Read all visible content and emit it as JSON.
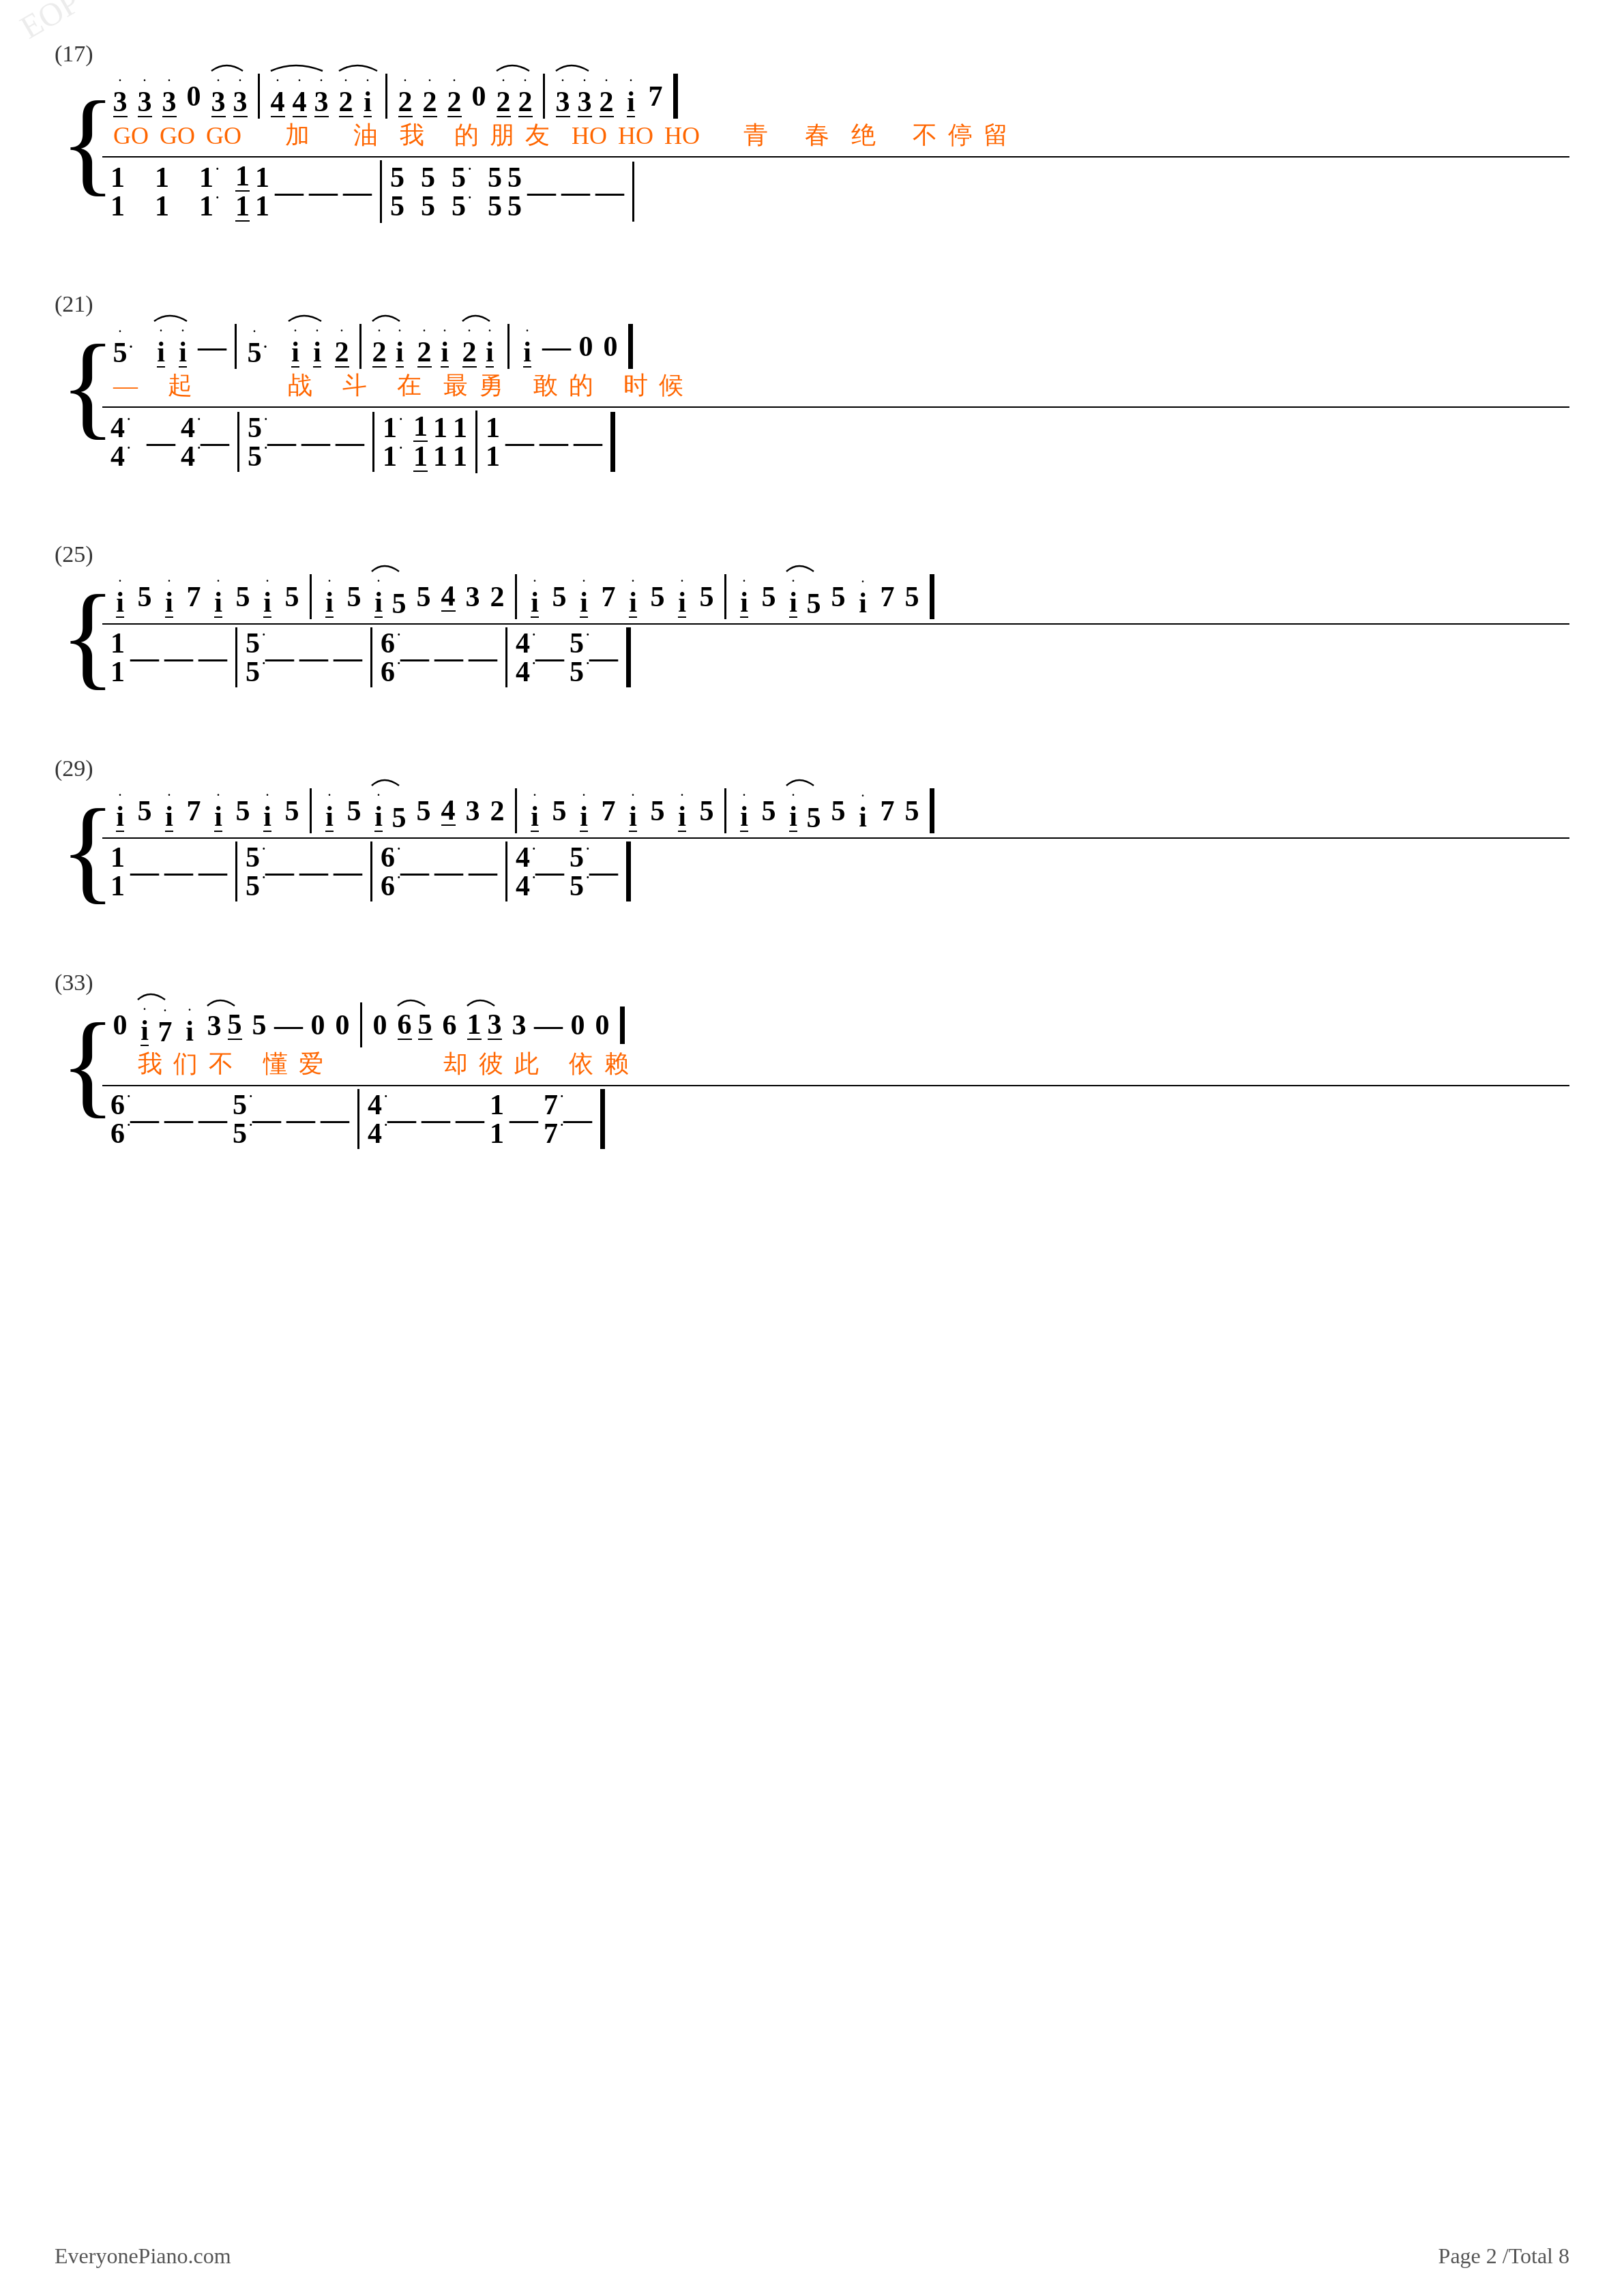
{
  "page": {
    "footer_left": "EveryonePiano.com",
    "footer_right": "Page 2 /Total 8"
  },
  "sections": [
    {
      "id": "s17",
      "number": "(17)",
      "treble": {
        "notes_line": "ȧ3  ȧ3  ȧ3  0ẋ3 ȧ3ȧ3  ȧ4 4ȧ3 ȧ2ȧi  ȧ2  ȧ2  ȧ2  0ȧ2 ȧ2ȧ2  ȧ3 ȧ3ȧ2 ȧi ȧ7",
        "lyrics": "GO GO GO 加 油 我 的朋友 HO HO HO 青 春 绝 不停留"
      },
      "bass": {
        "notes_line": "1/1  1/1  1·/1·  1/1 1/1  - - -  5/5 5/5 5·/5· 5/5 5/5  - - -"
      }
    },
    {
      "id": "s21",
      "number": "(21)",
      "treble": {
        "notes_line": "ȧ5· ȧi ȧi - | ȧ5· ȧi ȧi ȧ2 | ȧ2ȧi ȧ2ȧi ȧ2ȧi | ȧi - 0 0",
        "lyrics": "— 起  战 斗 在 最勇 敢的 时候"
      },
      "bass": {
        "notes_line": "4/4 - 4/4 - | 5/5 - - - | 1·/1· 1/1 1/1 1/1 | 1/1 - - -"
      }
    },
    {
      "id": "s25",
      "number": "(25)",
      "treble": {
        "notes_line": "ȧi5 ȧi7 ȧi5 ȧi5 | ȧi5 ȧi5 54 32 | ȧi5 ȧi7 ȧi5 ȧi5 | ȧi5 ȧi5 5i 75"
      },
      "bass": {
        "notes_line": "1/1 - - - | 5/5 - - - | 6/6 - - - | 4/4 - 5/5 -"
      }
    },
    {
      "id": "s29",
      "number": "(29)",
      "treble": {
        "notes_line": "ȧi5 ȧi7 ȧi5 ȧi5 | ȧi5 ȧi5 54 32 | ȧi5 ȧi7 ȧi5 ȧi5 | ȧi5 ȧi5 5i 75"
      },
      "bass": {
        "notes_line": "1/1 - - - | 5/5 - - - | 6/6 - - - | 4/4 - 5/5 -"
      }
    },
    {
      "id": "s33",
      "number": "(33)",
      "treble": {
        "notes_line": "0 ȧi7ȧi 3ȧ5 5 - 0 0 | 0 65ȧ6 1ȧ3 3 - 0 0",
        "lyrics": "我们不 懂爱   却彼此 依赖"
      },
      "bass": {
        "notes_line": "6/6 - - - | 5/5 - - - | 4/4 - - - | 1/1 - 7/7 -"
      }
    }
  ]
}
